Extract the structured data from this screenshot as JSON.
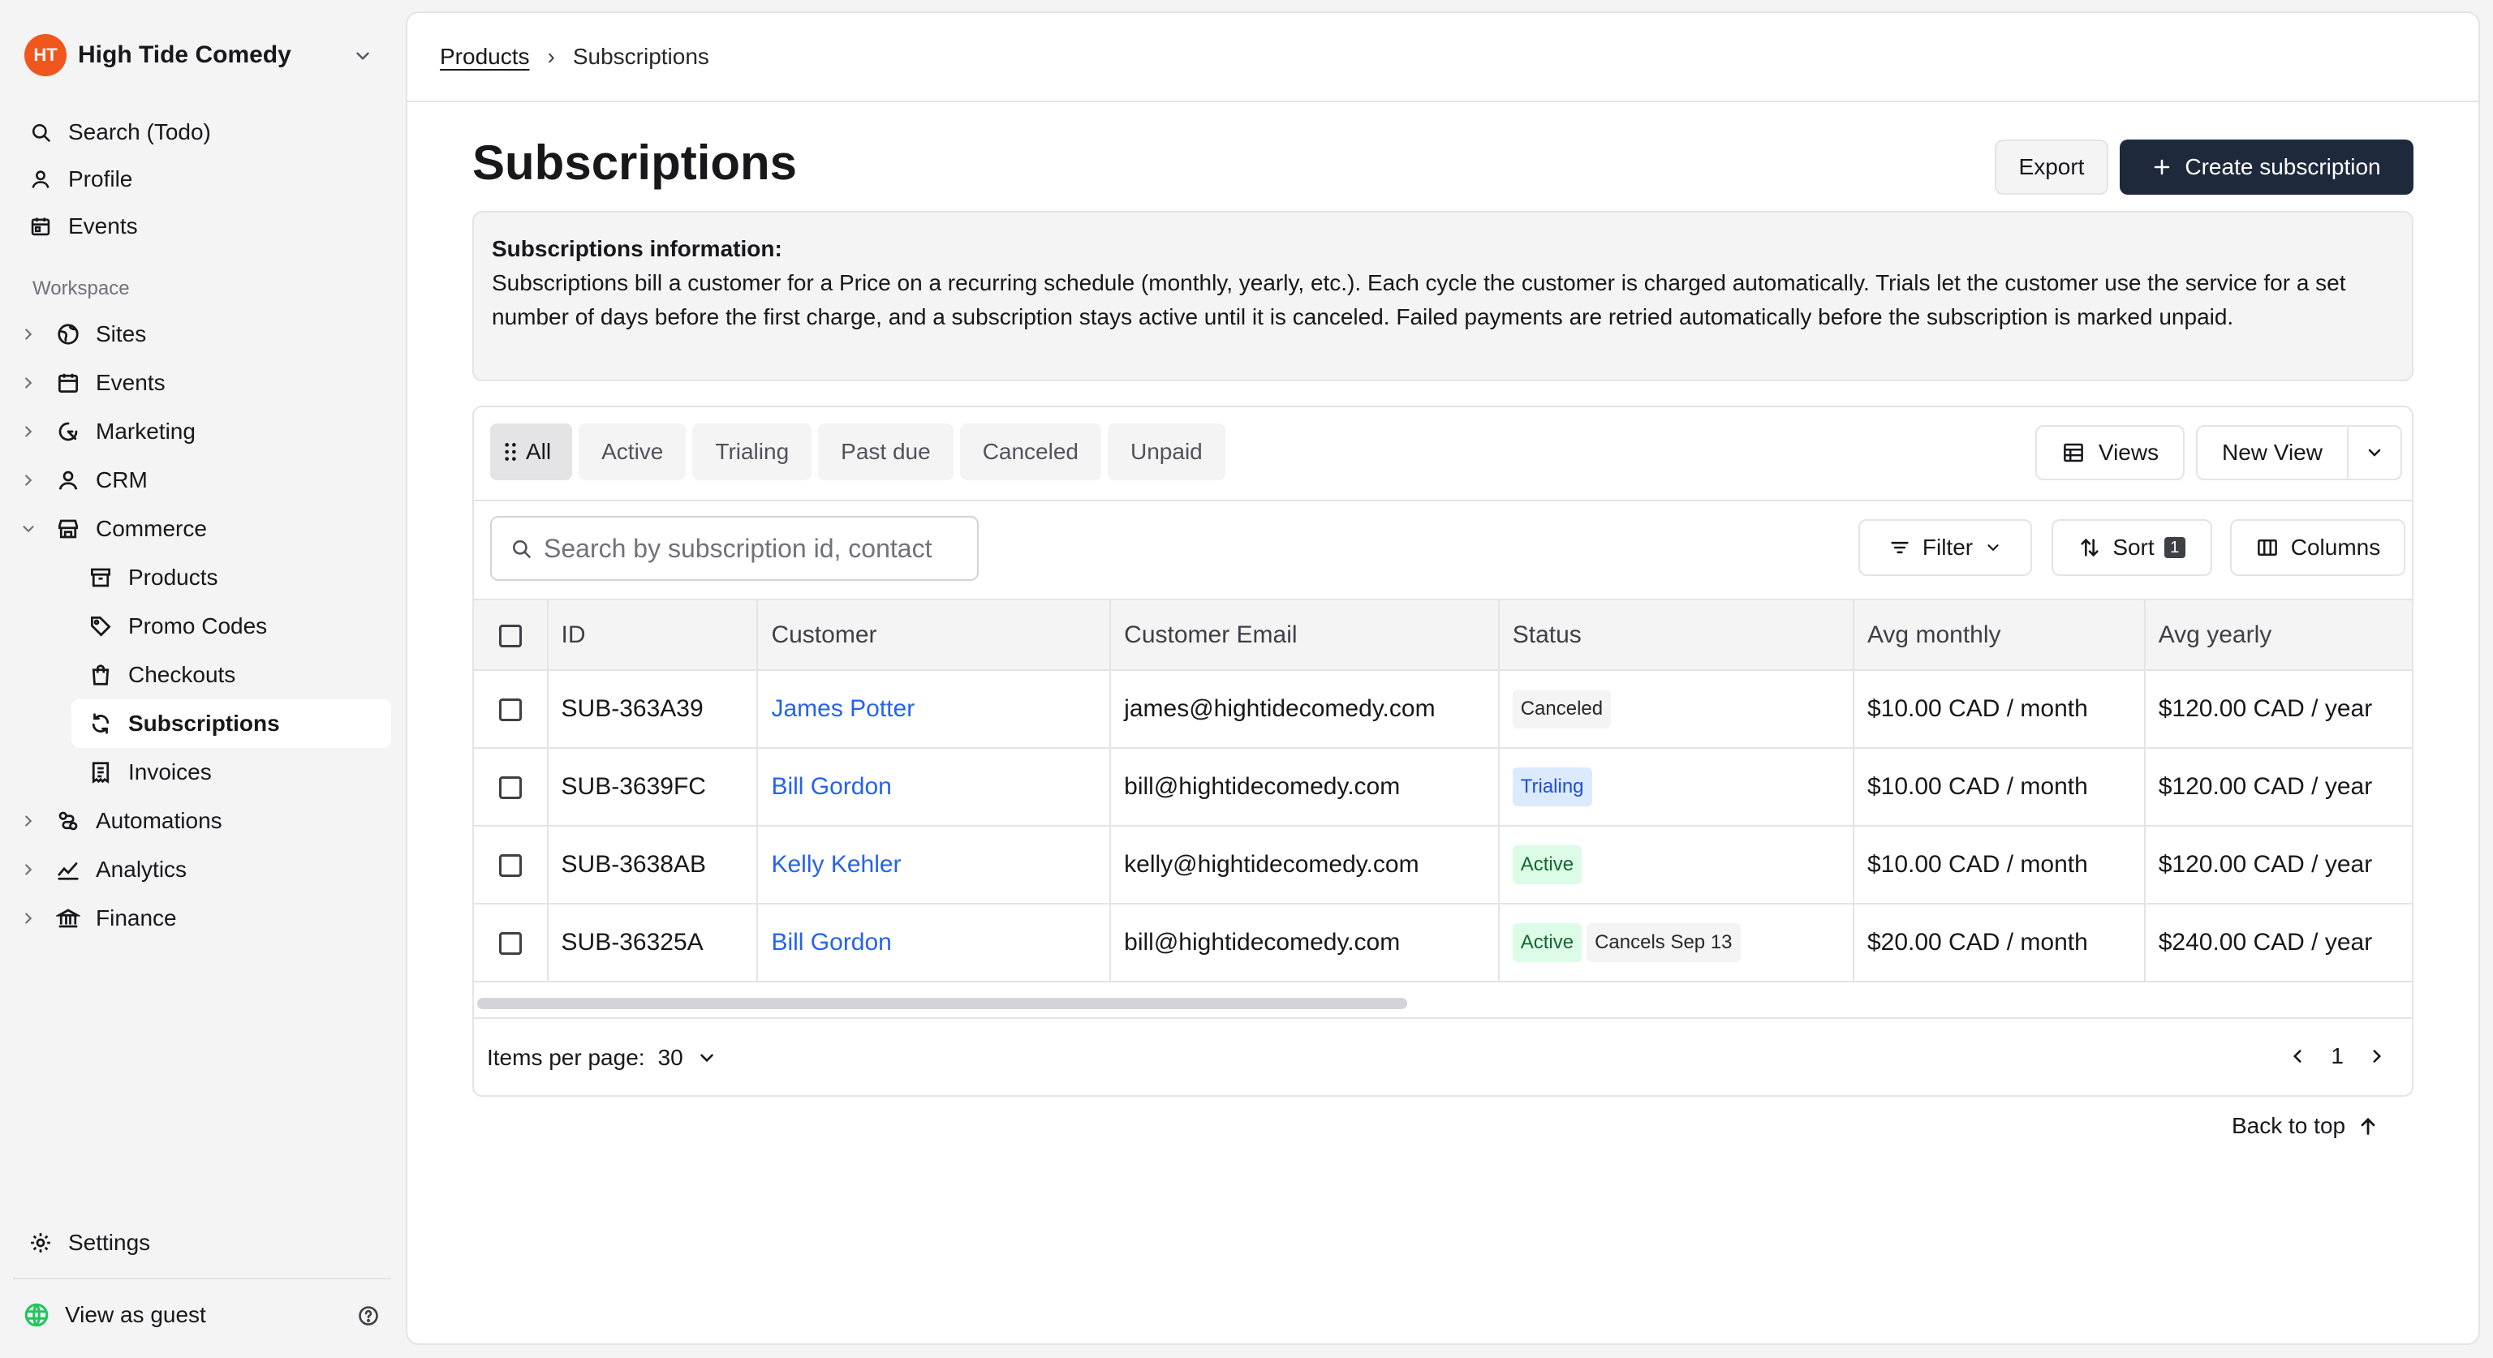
{
  "org": {
    "logo_text": "HT",
    "name": "High Tide Comedy",
    "brand_color": "#f0561d"
  },
  "nav_top": [
    {
      "label": "Search (Todo)",
      "icon": "search-icon"
    },
    {
      "label": "Profile",
      "icon": "user-icon"
    },
    {
      "label": "Events",
      "icon": "calendar-icon"
    }
  ],
  "workspace": {
    "label": "Workspace",
    "items": [
      {
        "label": "Sites",
        "icon": "globe-icon"
      },
      {
        "label": "Events",
        "icon": "calendar-icon"
      },
      {
        "label": "Marketing",
        "icon": "marketing-icon"
      },
      {
        "label": "CRM",
        "icon": "user-icon"
      },
      {
        "label": "Commerce",
        "icon": "store-icon",
        "expanded": true
      },
      {
        "label": "Automations",
        "icon": "automations-icon"
      },
      {
        "label": "Analytics",
        "icon": "analytics-icon"
      },
      {
        "label": "Finance",
        "icon": "bank-icon"
      }
    ],
    "commerce_children": [
      {
        "label": "Products",
        "icon": "archive-icon"
      },
      {
        "label": "Promo Codes",
        "icon": "tag-icon"
      },
      {
        "label": "Checkouts",
        "icon": "bag-icon"
      },
      {
        "label": "Subscriptions",
        "icon": "refresh-icon",
        "active": true
      },
      {
        "label": "Invoices",
        "icon": "receipt-icon"
      }
    ]
  },
  "settings_label": "Settings",
  "guest_label": "View as guest",
  "breadcrumb": {
    "parent": "Products",
    "separator": "›",
    "current": "Subscriptions"
  },
  "page": {
    "title": "Subscriptions",
    "export_label": "Export",
    "create_label": "Create subscription"
  },
  "info": {
    "heading": "Subscriptions information:",
    "body": "Subscriptions bill a customer for a Price on a recurring schedule (monthly, yearly, etc.). Each cycle the customer is charged automatically. Trials let the customer use the service for a set number of days before the first charge, and a subscription stays active until it is canceled. Failed payments are retried automatically before the subscription is marked unpaid."
  },
  "tabs": [
    "All",
    "Active",
    "Trialing",
    "Past due",
    "Canceled",
    "Unpaid"
  ],
  "views_label": "Views",
  "new_view_label": "New View",
  "search_placeholder": "Search by subscription id, contact",
  "filter_label": "Filter",
  "sort_label": "Sort",
  "sort_count": "1",
  "columns_label": "Columns",
  "table": {
    "headers": [
      "ID",
      "Customer",
      "Customer Email",
      "Status",
      "Avg monthly",
      "Avg yearly"
    ],
    "rows": [
      {
        "id": "SUB-363A39",
        "customer": "James Potter",
        "email": "james@hightidecomedy.com",
        "status": "Canceled",
        "note": "",
        "monthly": "$10.00 CAD / month",
        "yearly": "$120.00 CAD / year"
      },
      {
        "id": "SUB-3639FC",
        "customer": "Bill Gordon",
        "email": "bill@hightidecomedy.com",
        "status": "Trialing",
        "note": "",
        "monthly": "$10.00 CAD / month",
        "yearly": "$120.00 CAD / year"
      },
      {
        "id": "SUB-3638AB",
        "customer": "Kelly Kehler",
        "email": "kelly@hightidecomedy.com",
        "status": "Active",
        "note": "",
        "monthly": "$10.00 CAD / month",
        "yearly": "$120.00 CAD / year"
      },
      {
        "id": "SUB-36325A",
        "customer": "Bill Gordon",
        "email": "bill@hightidecomedy.com",
        "status": "Active",
        "note": "Cancels Sep 13",
        "monthly": "$20.00 CAD / month",
        "yearly": "$240.00 CAD / year"
      }
    ]
  },
  "pagination": {
    "items_per_page_label": "Items per page:",
    "items_per_page": "30",
    "page": "1"
  },
  "back_to_top_label": "Back to top",
  "colors": {
    "primary_button": "#1e293b",
    "link": "#2563eb",
    "active_badge": "#dcfce7",
    "trialing_badge": "#dbeafe"
  }
}
